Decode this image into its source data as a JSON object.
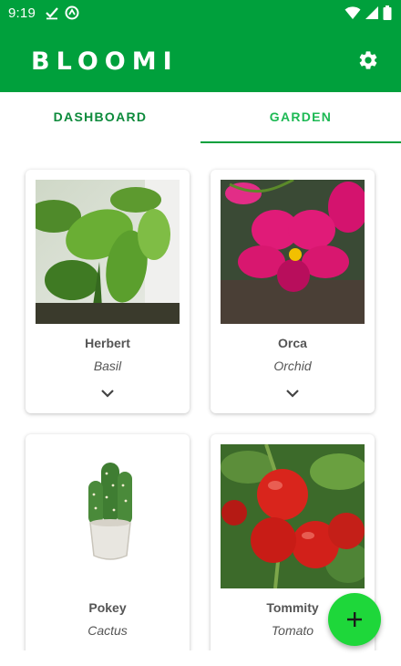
{
  "status_bar": {
    "time": "9:19"
  },
  "app_bar": {
    "title": "BLOOMI"
  },
  "tabs": [
    {
      "label": "DASHBOARD",
      "active": false
    },
    {
      "label": "GARDEN",
      "active": true
    }
  ],
  "plants": [
    {
      "name": "Herbert",
      "species": "Basil",
      "image": "basil-photo"
    },
    {
      "name": "Orca",
      "species": "Orchid",
      "image": "orchid-photo"
    },
    {
      "name": "Pokey",
      "species": "Cactus",
      "image": "cactus-photo"
    },
    {
      "name": "Tommity",
      "species": "Tomato",
      "image": "tomato-photo"
    }
  ],
  "colors": {
    "primary": "#00A03C",
    "fab": "#1ED73A",
    "tab_active": "#1DB954",
    "tab_inactive": "#0C8A3B"
  }
}
